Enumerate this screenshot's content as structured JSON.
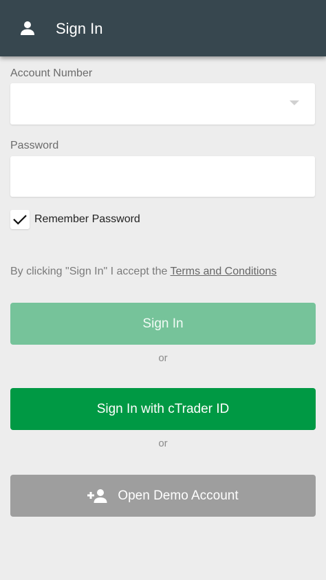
{
  "header": {
    "title": "Sign In",
    "icon": "person-icon",
    "background": "#37474f"
  },
  "account": {
    "label": "Account Number",
    "value": "",
    "placeholder": ""
  },
  "password": {
    "label": "Password",
    "value": "",
    "placeholder": ""
  },
  "remember": {
    "label": "Remember Password",
    "checked": true
  },
  "terms": {
    "prefix": "By clicking \"Sign In\" I accept the ",
    "link": "Terms and Conditions"
  },
  "buttons": {
    "sign_in": "Sign In",
    "or1": "or",
    "ctrader": "Sign In with cTrader ID",
    "or2": "or",
    "demo": "Open Demo Account"
  },
  "colors": {
    "sign_in": "#76c39a",
    "ctrader": "#009944",
    "demo": "#9e9e9e",
    "background": "#ededed"
  }
}
